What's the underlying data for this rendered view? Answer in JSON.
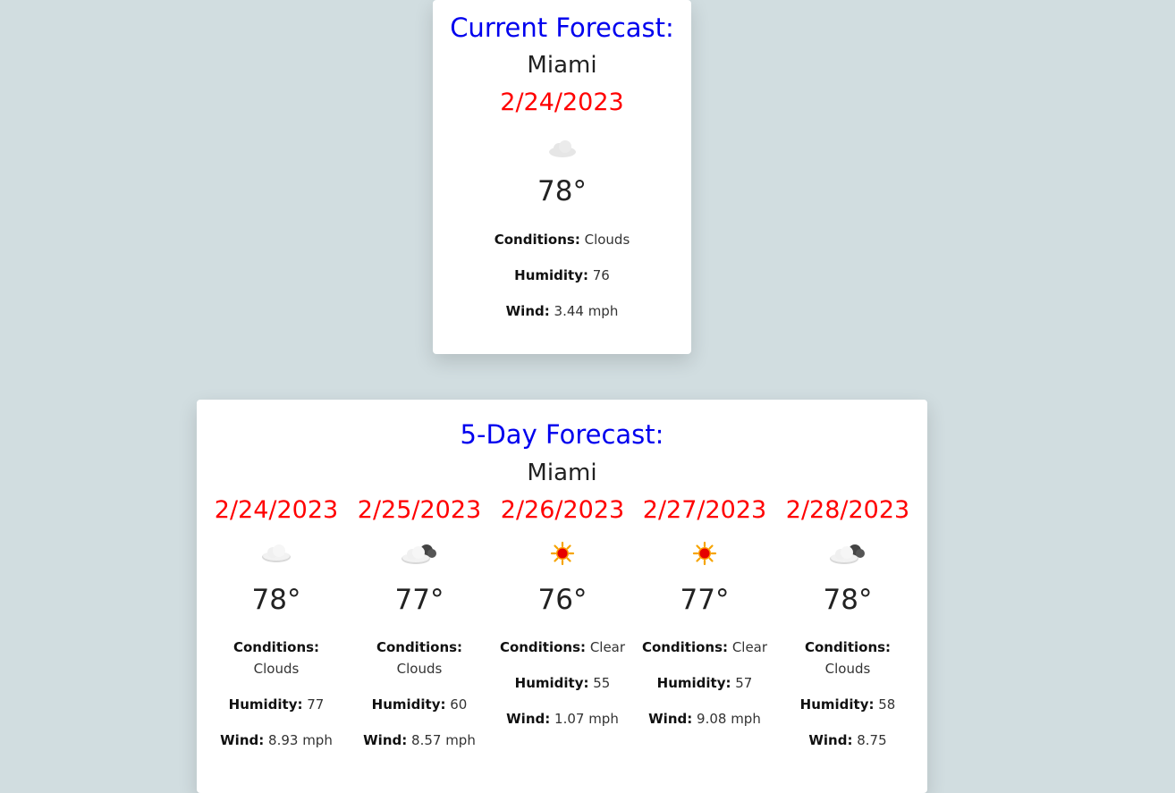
{
  "current": {
    "heading": "Current Forecast:",
    "city": "Miami",
    "date": "2/24/2023",
    "icon": "cloud-icon",
    "temp": "78°",
    "conditions_label": "Conditions:",
    "conditions": "Clouds",
    "humidity_label": "Humidity:",
    "humidity": "76",
    "wind_label": "Wind:",
    "wind": "3.44 mph"
  },
  "five_day": {
    "heading": "5-Day Forecast:",
    "city": "Miami",
    "days": [
      {
        "date": "2/24/2023",
        "icon": "cloud-icon",
        "temp": "78°",
        "conditions_label": "Conditions:",
        "conditions": "Clouds",
        "humidity_label": "Humidity:",
        "humidity": "77",
        "wind_label": "Wind:",
        "wind": "8.93 mph"
      },
      {
        "date": "2/25/2023",
        "icon": "dark-cloud-icon",
        "temp": "77°",
        "conditions_label": "Conditions:",
        "conditions": "Clouds",
        "humidity_label": "Humidity:",
        "humidity": "60",
        "wind_label": "Wind:",
        "wind": "8.57 mph"
      },
      {
        "date": "2/26/2023",
        "icon": "sun-icon",
        "temp": "76°",
        "conditions_label": "Conditions:",
        "conditions": "Clear",
        "humidity_label": "Humidity:",
        "humidity": "55",
        "wind_label": "Wind:",
        "wind": "1.07 mph"
      },
      {
        "date": "2/27/2023",
        "icon": "sun-icon",
        "temp": "77°",
        "conditions_label": "Conditions:",
        "conditions": "Clear",
        "humidity_label": "Humidity:",
        "humidity": "57",
        "wind_label": "Wind:",
        "wind": "9.08 mph"
      },
      {
        "date": "2/28/2023",
        "icon": "dark-cloud-icon",
        "temp": "78°",
        "conditions_label": "Conditions:",
        "conditions": "Clouds",
        "humidity_label": "Humidity:",
        "humidity": "58",
        "wind_label": "Wind:",
        "wind": "8.75"
      }
    ]
  },
  "colors": {
    "background": "#d1dde0",
    "heading": "#0000ee",
    "date": "#ff0000"
  }
}
